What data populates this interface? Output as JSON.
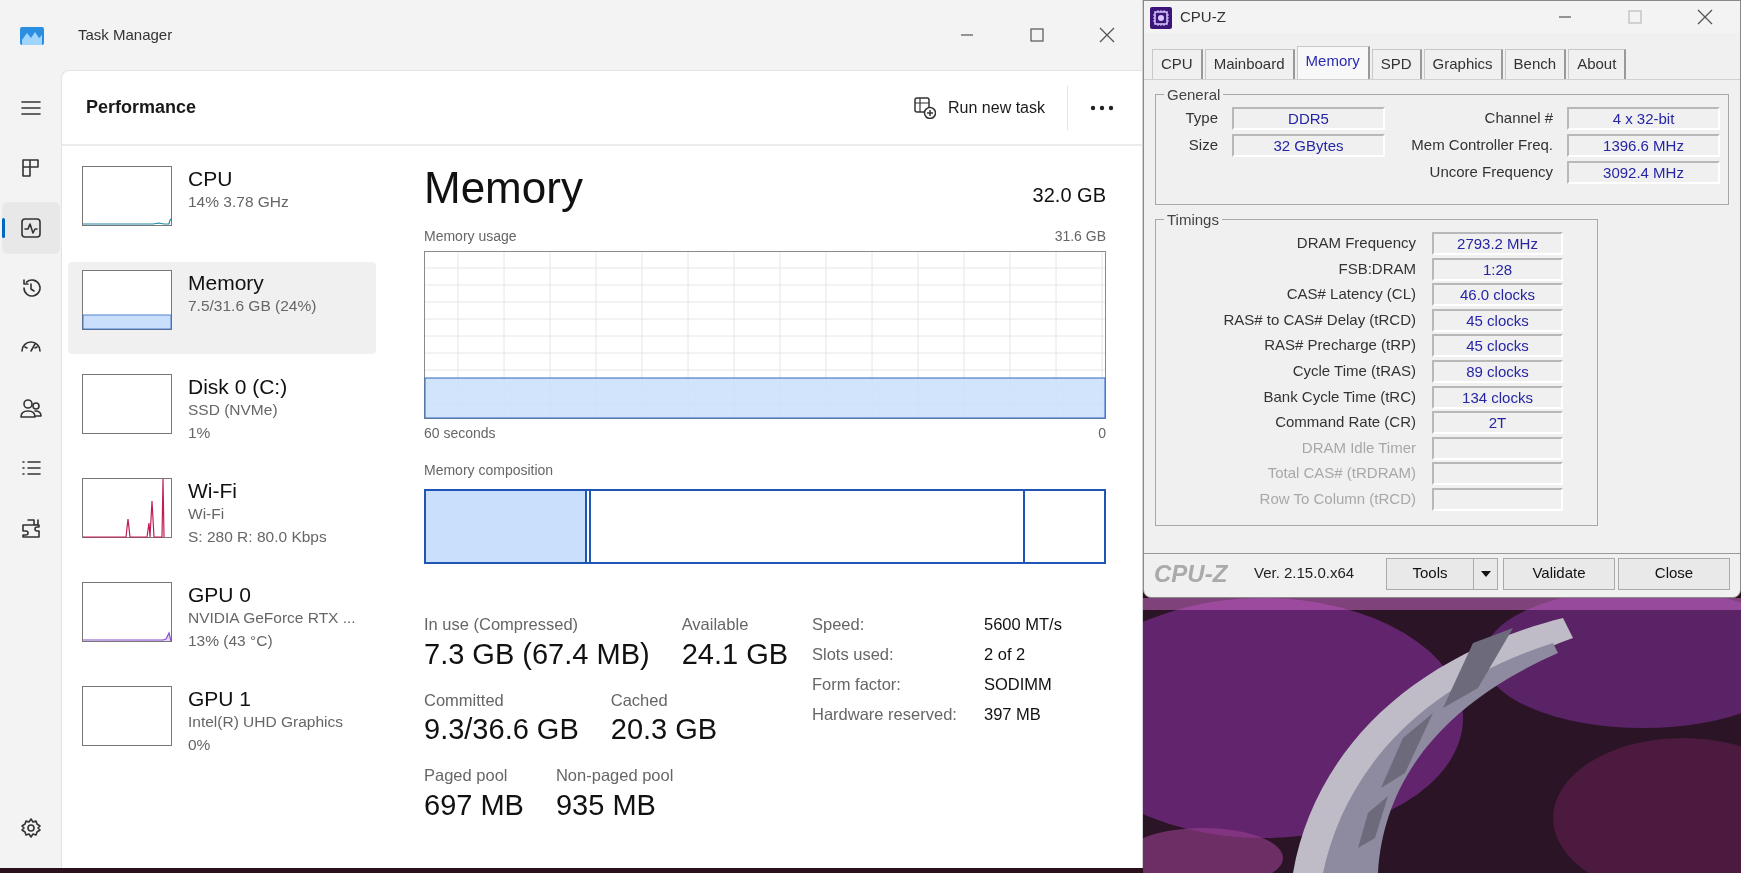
{
  "task_manager": {
    "window_title": "Task Manager",
    "nav": [
      {
        "kind": "menu",
        "selected": false
      },
      {
        "kind": "processes",
        "selected": false
      },
      {
        "kind": "performance",
        "selected": true
      },
      {
        "kind": "history",
        "selected": false
      },
      {
        "kind": "startup",
        "selected": false
      },
      {
        "kind": "users",
        "selected": false
      },
      {
        "kind": "details",
        "selected": false
      },
      {
        "kind": "services",
        "selected": false
      },
      {
        "kind": "settings",
        "selected": false
      }
    ],
    "page_title": "Performance",
    "run_new_task": "Run new task",
    "resources": [
      {
        "kind": "cpu",
        "name": "CPU",
        "lines": [
          "14%  3.78 GHz"
        ],
        "selected": false
      },
      {
        "kind": "memory",
        "name": "Memory",
        "lines": [
          "7.5/31.6 GB (24%)"
        ],
        "selected": true
      },
      {
        "kind": "disk",
        "name": "Disk 0 (C:)",
        "lines": [
          "SSD (NVMe)",
          "1%"
        ],
        "selected": false
      },
      {
        "kind": "wifi",
        "name": "Wi-Fi",
        "lines": [
          "Wi-Fi",
          "S: 280  R: 80.0 Kbps"
        ],
        "selected": false
      },
      {
        "kind": "gpu",
        "name": "GPU 0",
        "lines": [
          "NVIDIA GeForce RTX ...",
          "13%  (43 °C)"
        ],
        "selected": false
      },
      {
        "kind": "idle",
        "name": "GPU 1",
        "lines": [
          "Intel(R) UHD Graphics",
          "0%"
        ],
        "selected": false
      }
    ],
    "detail": {
      "title": "Memory",
      "total": "32.0 GB",
      "usage_graph": {
        "label": "Memory usage",
        "max": "31.6 GB",
        "span": "60 seconds",
        "min": "0"
      },
      "composition": {
        "label": "Memory composition"
      },
      "stats": [
        [
          {
            "label": "In use (Compressed)",
            "value": "7.3 GB (67.4 MB)"
          },
          {
            "label": "Available",
            "value": "24.1 GB"
          }
        ],
        [
          {
            "label": "Committed",
            "value": "9.3/36.6 GB"
          },
          {
            "label": "Cached",
            "value": "20.3 GB"
          }
        ],
        [
          {
            "label": "Paged pool",
            "value": "697 MB"
          },
          {
            "label": "Non-paged pool",
            "value": "935 MB"
          }
        ]
      ],
      "properties": [
        {
          "label": "Speed:",
          "value": "5600 MT/s"
        },
        {
          "label": "Slots used:",
          "value": "2 of 2"
        },
        {
          "label": "Form factor:",
          "value": "SODIMM"
        },
        {
          "label": "Hardware reserved:",
          "value": "397 MB"
        }
      ]
    }
  },
  "cpuz": {
    "window_title": "CPU-Z",
    "tabs": [
      {
        "label": "CPU",
        "selected": false
      },
      {
        "label": "Mainboard",
        "selected": false
      },
      {
        "label": "Memory",
        "selected": true
      },
      {
        "label": "SPD",
        "selected": false
      },
      {
        "label": "Graphics",
        "selected": false
      },
      {
        "label": "Bench",
        "selected": false
      },
      {
        "label": "About",
        "selected": false
      }
    ],
    "general": {
      "title": "General",
      "left": [
        {
          "label": "Type",
          "value": "DDR5"
        },
        {
          "label": "Size",
          "value": "32 GBytes"
        }
      ],
      "right": [
        {
          "label": "Channel #",
          "value": "4 x 32-bit"
        },
        {
          "label": "Mem Controller Freq.",
          "value": "1396.6 MHz"
        },
        {
          "label": "Uncore Frequency",
          "value": "3092.4 MHz"
        }
      ]
    },
    "timings": {
      "title": "Timings",
      "rows": [
        {
          "label": "DRAM Frequency",
          "value": "2793.2 MHz",
          "disabled": false
        },
        {
          "label": "FSB:DRAM",
          "value": "1:28",
          "disabled": false
        },
        {
          "label": "CAS# Latency (CL)",
          "value": "46.0 clocks",
          "disabled": false
        },
        {
          "label": "RAS# to CAS# Delay (tRCD)",
          "value": "45 clocks",
          "disabled": false
        },
        {
          "label": "RAS# Precharge (tRP)",
          "value": "45 clocks",
          "disabled": false
        },
        {
          "label": "Cycle Time (tRAS)",
          "value": "89 clocks",
          "disabled": false
        },
        {
          "label": "Bank Cycle Time (tRC)",
          "value": "134 clocks",
          "disabled": false
        },
        {
          "label": "Command Rate (CR)",
          "value": "2T",
          "disabled": false
        },
        {
          "label": "DRAM Idle Timer",
          "disabled": true
        },
        {
          "label": "Total CAS# (tRDRAM)",
          "disabled": true
        },
        {
          "label": "Row To Column (tRCD)",
          "disabled": true
        }
      ]
    },
    "footer": {
      "brand": "CPU-Z",
      "version": "Ver. 2.15.0.x64",
      "buttons": [
        {
          "label": "Tools",
          "kind": "split"
        },
        {
          "label": "Validate",
          "kind": "plain"
        },
        {
          "label": "Close",
          "kind": "plain"
        }
      ]
    }
  }
}
